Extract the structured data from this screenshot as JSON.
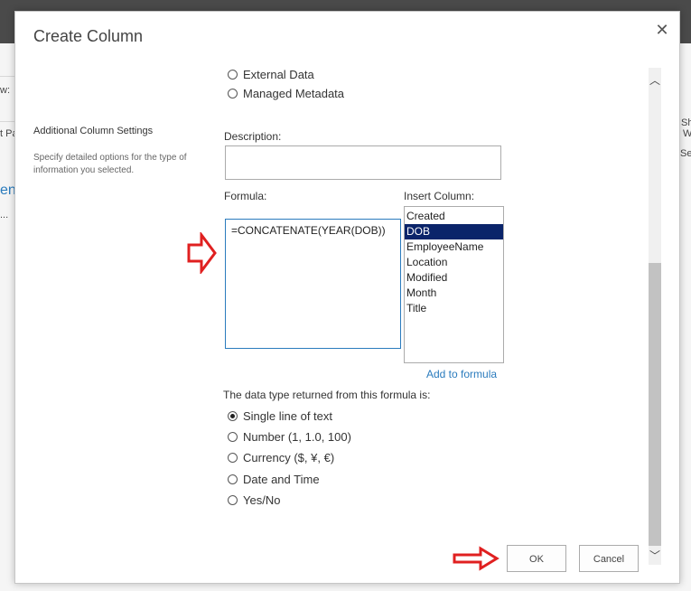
{
  "dialog": {
    "title": "Create Column",
    "close_glyph": "✕"
  },
  "background": {
    "left_text_1": "w:",
    "left_text_2": "t Pa",
    "left_text_3": "en",
    "left_text_4": "...",
    "right_text_1": "Sha",
    "right_text_2": "W",
    "right_text_3": "Set"
  },
  "type_options": [
    {
      "label": "External Data",
      "checked": false
    },
    {
      "label": "Managed Metadata",
      "checked": false
    }
  ],
  "additional_settings": {
    "title": "Additional Column Settings",
    "description": "Specify detailed options for the type of information you selected."
  },
  "description_field": {
    "label": "Description:",
    "value": ""
  },
  "formula_field": {
    "label": "Formula:",
    "value": "=CONCATENATE(YEAR(DOB))"
  },
  "insert_column": {
    "label": "Insert Column:",
    "items": [
      "Created",
      "DOB",
      "EmployeeName",
      "Location",
      "Modified",
      "Month",
      "Title"
    ],
    "selected": "DOB",
    "add_link": "Add to formula"
  },
  "return_type": {
    "label": "The data type returned from this formula is:",
    "options": [
      {
        "label": "Single line of text",
        "checked": true
      },
      {
        "label": "Number (1, 1.0, 100)",
        "checked": false
      },
      {
        "label": "Currency ($, ¥, €)",
        "checked": false
      },
      {
        "label": "Date and Time",
        "checked": false
      },
      {
        "label": "Yes/No",
        "checked": false
      }
    ]
  },
  "buttons": {
    "ok": "OK",
    "cancel": "Cancel"
  },
  "scrollbar": {
    "up_glyph": "︿",
    "down_glyph": "﹀"
  },
  "colors": {
    "accent": "#2a7bbd",
    "arrow": "#e02020",
    "selected_bg": "#0a246a"
  }
}
